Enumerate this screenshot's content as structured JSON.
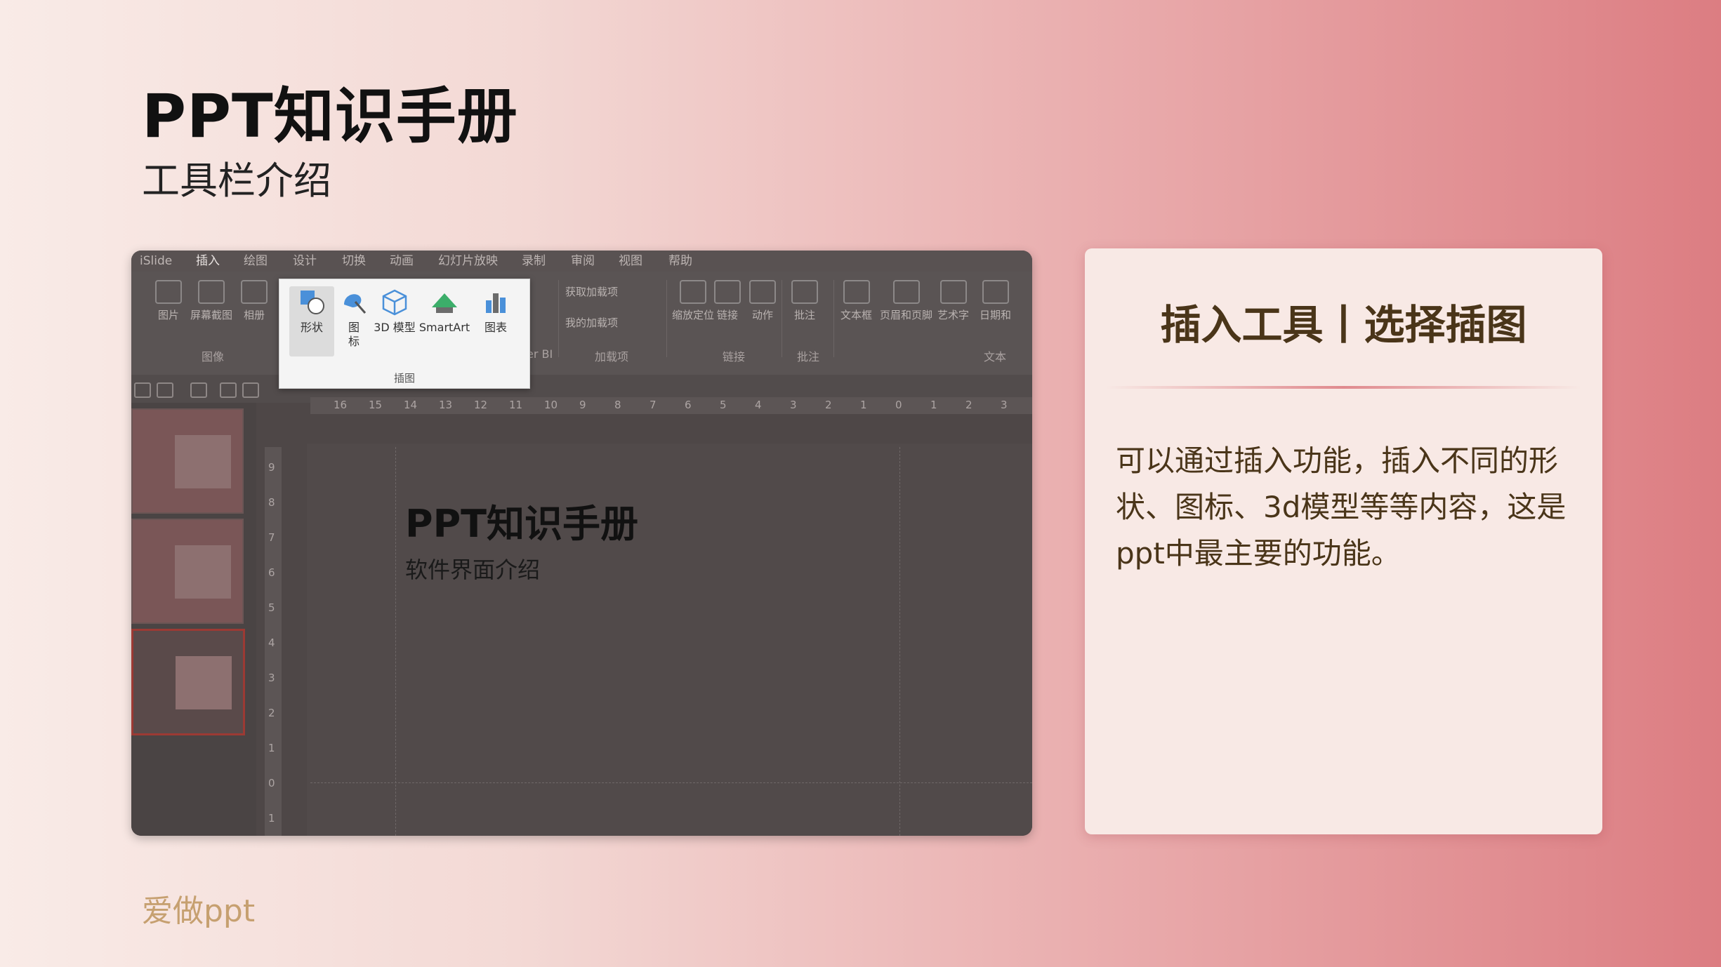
{
  "header": {
    "title": "PPT知识手册",
    "subtitle": "工具栏介绍"
  },
  "footer": {
    "brand": "爱做ppt"
  },
  "screenshot": {
    "tabs": [
      {
        "label": "iSlide",
        "active": false
      },
      {
        "label": "插入",
        "active": true
      },
      {
        "label": "绘图",
        "active": false
      },
      {
        "label": "设计",
        "active": false
      },
      {
        "label": "切换",
        "active": false
      },
      {
        "label": "动画",
        "active": false
      },
      {
        "label": "幻灯片放映",
        "active": false
      },
      {
        "label": "录制",
        "active": false
      },
      {
        "label": "审阅",
        "active": false
      },
      {
        "label": "视图",
        "active": false
      },
      {
        "label": "帮助",
        "active": false
      }
    ],
    "ribbon_left": [
      "图片",
      "屏幕截图",
      "相册"
    ],
    "ribbon_right": [
      "获取加载项",
      "我的加载项",
      "缩放定位",
      "链接",
      "动作",
      "批注",
      "文本框",
      "页眉和页脚",
      "艺术字",
      "日期和"
    ],
    "group_labels": {
      "image": "图像",
      "addins": "加载项",
      "links": "链接",
      "comments": "批注",
      "text": "文本",
      "powerbi": "er BI"
    },
    "highlight": {
      "buttons": [
        {
          "label": "形状",
          "icon": "shapes-icon"
        },
        {
          "label": "图标",
          "icon": "icons-icon"
        },
        {
          "label": "3D 模型",
          "icon": "3d-model-icon"
        },
        {
          "label": "SmartArt",
          "icon": "smartart-icon"
        },
        {
          "label": "图表",
          "icon": "chart-icon"
        }
      ],
      "group_label": "插图"
    },
    "ruler_numbers": [
      "16",
      "15",
      "14",
      "13",
      "12",
      "11",
      "10",
      "9",
      "8",
      "7",
      "6",
      "5",
      "4",
      "3",
      "2",
      "1",
      "0",
      "1",
      "2",
      "3"
    ],
    "vruler_numbers": [
      "9",
      "8",
      "7",
      "6",
      "5",
      "4",
      "3",
      "2",
      "1",
      "0",
      "1"
    ],
    "slide": {
      "title": "PPT知识手册",
      "subtitle": "软件界面介绍"
    }
  },
  "card": {
    "title": "插入工具丨选择插图",
    "body": "可以通过插入功能，插入不同的形状、图标、3d模型等等内容，这是ppt中最主要的功能。"
  },
  "colors": {
    "accent": "#dc7d82",
    "card_text": "#4a3519",
    "footer": "#c6a070"
  }
}
